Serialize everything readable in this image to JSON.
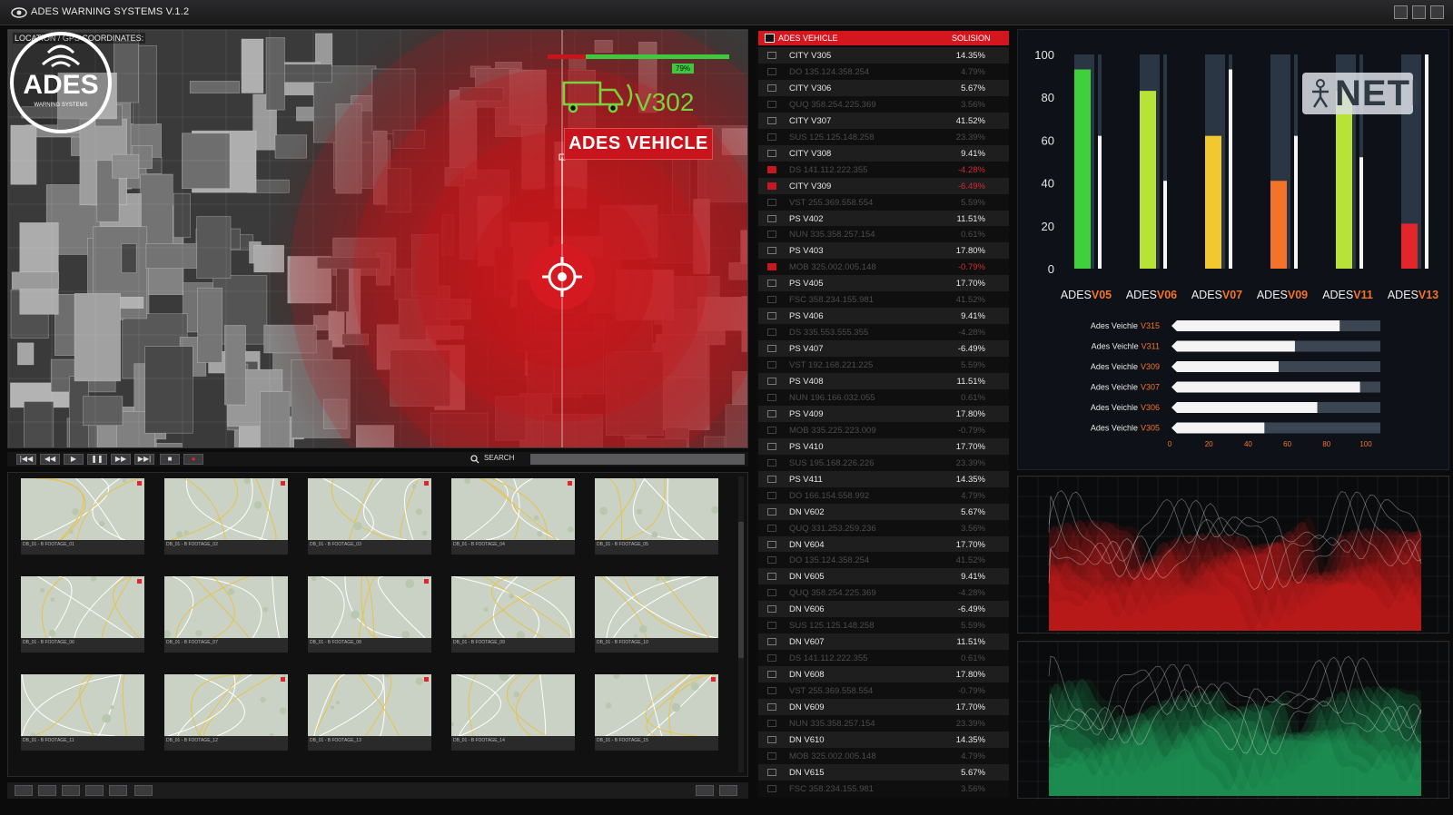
{
  "window": {
    "title": "ADES WARNING SYSTEMS V.1.2"
  },
  "map": {
    "location_label": "LOCATION / GPS COORDINATES:",
    "logo_text": "ADES",
    "logo_subtext": "WARNING SYSTEMS",
    "vehicle_badge": "ADES VEHICLE",
    "vehicle_code": "V302",
    "signal_tag": "79%",
    "signal_level": 0.79
  },
  "transport": {
    "search_label": "SEARCH"
  },
  "thumbnails": [
    {
      "caption": "DB_01 - B FOOTAGE_01"
    },
    {
      "caption": "DB_01 - B FOOTAGE_02"
    },
    {
      "caption": "DB_01 - B FOOTAGE_03"
    },
    {
      "caption": "DB_01 - B FOOTAGE_04"
    },
    {
      "caption": "DB_01 - B FOOTAGE_05"
    },
    {
      "caption": "DB_01 - B FOOTAGE_06"
    },
    {
      "caption": "DB_01 - B FOOTAGE_07"
    },
    {
      "caption": "DB_01 - B FOOTAGE_08"
    },
    {
      "caption": "DB_01 - B FOOTAGE_09"
    },
    {
      "caption": "DB_01 - B FOOTAGE_10"
    },
    {
      "caption": "DB_01 - B FOOTAGE_11"
    },
    {
      "caption": "DB_01 - B FOOTAGE_12"
    },
    {
      "caption": "DB_01 - B FOOTAGE_13"
    },
    {
      "caption": "DB_01 - B FOOTAGE_14"
    },
    {
      "caption": "DB_01 - B FOOTAGE_15"
    }
  ],
  "table": {
    "header_left": "ADES VEHICLE",
    "header_right": "SOLISION",
    "rows": [
      {
        "name": "CITY V305",
        "value": "14.35%",
        "type": "main"
      },
      {
        "name": "DO    135.124.358.254",
        "value": "4.79%",
        "type": "sub"
      },
      {
        "name": "CITY V306",
        "value": "5.67%",
        "type": "main"
      },
      {
        "name": "QUQ   358.254.225.369",
        "value": "3.56%",
        "type": "sub"
      },
      {
        "name": "CITY V307",
        "value": "41.52%",
        "type": "main"
      },
      {
        "name": "SUS   125.125.148.258",
        "value": "23.39%",
        "type": "sub"
      },
      {
        "name": "CITY V308",
        "value": "9.41%",
        "type": "main"
      },
      {
        "name": "DS    141.112.222.355",
        "value": "-4.28%",
        "type": "sub",
        "alert": true
      },
      {
        "name": "CITY V309",
        "value": "-6.49%",
        "type": "main",
        "alert": true
      },
      {
        "name": "VST   255.369.558.554",
        "value": "5.59%",
        "type": "sub"
      },
      {
        "name": "PS V402",
        "value": "11.51%",
        "type": "main"
      },
      {
        "name": "NUN   335.358.257.154",
        "value": "0.61%",
        "type": "sub"
      },
      {
        "name": "PS V403",
        "value": "17.80%",
        "type": "main"
      },
      {
        "name": "MOB   325.002.005.148",
        "value": "-0.79%",
        "type": "sub",
        "alert": true
      },
      {
        "name": "PS V405",
        "value": "17.70%",
        "type": "main"
      },
      {
        "name": "FSC   358.234.155.981",
        "value": "41.52%",
        "type": "sub"
      },
      {
        "name": "PS V406",
        "value": "9.41%",
        "type": "main"
      },
      {
        "name": "DS    335.553.555.355",
        "value": "-4.28%",
        "type": "sub"
      },
      {
        "name": "PS V407",
        "value": "-6.49%",
        "type": "main"
      },
      {
        "name": "VST   192.168.221.225",
        "value": "5.59%",
        "type": "sub"
      },
      {
        "name": "PS V408",
        "value": "11.51%",
        "type": "main"
      },
      {
        "name": "NUN   196.166.032.055",
        "value": "0.61%",
        "type": "sub"
      },
      {
        "name": "PS V409",
        "value": "17.80%",
        "type": "main"
      },
      {
        "name": "MOB   335.225.223.009",
        "value": "-0.79%",
        "type": "sub"
      },
      {
        "name": "PS V410",
        "value": "17.70%",
        "type": "main"
      },
      {
        "name": "SUS   195.168.226.226",
        "value": "23.39%",
        "type": "sub"
      },
      {
        "name": "PS V411",
        "value": "14.35%",
        "type": "main"
      },
      {
        "name": "DO    166.154.558.992",
        "value": "4.79%",
        "type": "sub"
      },
      {
        "name": "DN V602",
        "value": "5.67%",
        "type": "main"
      },
      {
        "name": "QUQ   331.253.259.236",
        "value": "3.56%",
        "type": "sub"
      },
      {
        "name": "DN V604",
        "value": "17.70%",
        "type": "main"
      },
      {
        "name": "DO    135.124.358.254",
        "value": "41.52%",
        "type": "sub"
      },
      {
        "name": "DN V605",
        "value": "9.41%",
        "type": "main"
      },
      {
        "name": "QUQ   358.254.225.369",
        "value": "-4.28%",
        "type": "sub"
      },
      {
        "name": "DN V606",
        "value": "-6.49%",
        "type": "main"
      },
      {
        "name": "SUS   125.125.148.258",
        "value": "5.59%",
        "type": "sub"
      },
      {
        "name": "DN V607",
        "value": "11.51%",
        "type": "main"
      },
      {
        "name": "DS    141.112.222.355",
        "value": "0.61%",
        "type": "sub"
      },
      {
        "name": "DN V608",
        "value": "17.80%",
        "type": "main"
      },
      {
        "name": "VST   255.369.558.554",
        "value": "-0.79%",
        "type": "sub"
      },
      {
        "name": "DN V609",
        "value": "17.70%",
        "type": "main"
      },
      {
        "name": "NUN   335.358.257.154",
        "value": "23.39%",
        "type": "sub"
      },
      {
        "name": "DN V610",
        "value": "14.35%",
        "type": "main"
      },
      {
        "name": "MOB   325.002.005.148",
        "value": "4.79%",
        "type": "sub"
      },
      {
        "name": "DN V615",
        "value": "5.67%",
        "type": "main"
      },
      {
        "name": "FSC   358.234.155.981",
        "value": "3.56%",
        "type": "sub"
      }
    ]
  },
  "neti_logo": "NETI",
  "chart_data": [
    {
      "type": "bar",
      "ylim": [
        0,
        100
      ],
      "yticks": [
        0,
        20,
        40,
        60,
        80,
        100
      ],
      "categories": [
        {
          "prefix": "ADES",
          "code": "V05"
        },
        {
          "prefix": "ADES",
          "code": "V06"
        },
        {
          "prefix": "ADES",
          "code": "V07"
        },
        {
          "prefix": "ADES",
          "code": "V09"
        },
        {
          "prefix": "ADES",
          "code": "V11"
        },
        {
          "prefix": "ADES",
          "code": "V13"
        }
      ],
      "values": [
        93,
        83,
        62,
        41,
        83,
        21
      ],
      "secondary_values": [
        62,
        41,
        93,
        62,
        52,
        100
      ],
      "bar_colors": [
        "#3fd03c",
        "#b6e336",
        "#f3c730",
        "#f2742a",
        "#b6e336",
        "#e3262c"
      ]
    },
    {
      "type": "bar",
      "orientation": "horizontal",
      "xlim": [
        0,
        100
      ],
      "xticks": [
        0,
        20,
        40,
        60,
        80,
        100
      ],
      "categories": [
        {
          "prefix": "Ades Veichle",
          "code": "V315"
        },
        {
          "prefix": "Ades Veichle",
          "code": "V311"
        },
        {
          "prefix": "Ades Veichle",
          "code": "V309"
        },
        {
          "prefix": "Ades Veichle",
          "code": "V307"
        },
        {
          "prefix": "Ades Veichle",
          "code": "V306"
        },
        {
          "prefix": "Ades Veichle",
          "code": "V305"
        }
      ],
      "values": [
        80,
        58,
        50,
        90,
        69,
        43
      ]
    }
  ],
  "colors": {
    "accent_red": "#d4161e",
    "accent_green": "#3fd03c",
    "code_orange": "#f2742a"
  }
}
